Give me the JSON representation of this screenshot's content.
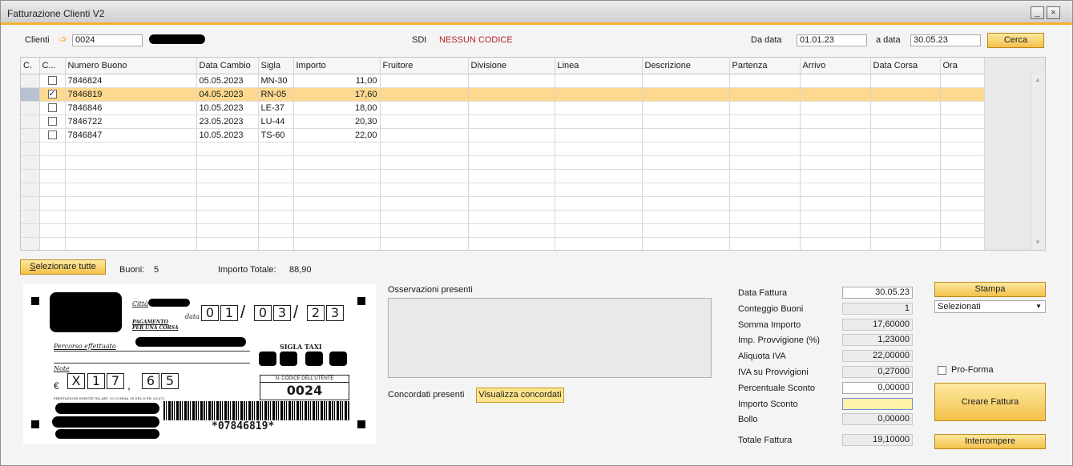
{
  "window": {
    "title": "Fatturazione Clienti V2",
    "minimize": "_",
    "close": "×"
  },
  "header": {
    "client_label": "Clienti",
    "client_value": "0024",
    "sdi_label": "SDI",
    "sdi_value": "NESSUN CODICE",
    "from_label": "Da data",
    "from_value": "01.01.23",
    "to_label": "a data",
    "to_value": "30.05.23",
    "search_button": "Cerca"
  },
  "grid": {
    "columns": [
      "C.",
      "C...",
      "Numero Buono",
      "Data Cambio",
      "Sigla",
      "Importo",
      "Fruitore",
      "Divisione",
      "Linea",
      "Descrizione",
      "Partenza",
      "Arrivo",
      "Data Corsa",
      "Ora"
    ],
    "rows": [
      {
        "checked": false,
        "numero": "7846824",
        "data": "05.05.2023",
        "sigla": "MN-30",
        "importo": "11,00"
      },
      {
        "checked": true,
        "numero": "7846819",
        "data": "04.05.2023",
        "sigla": "RN-05",
        "importo": "17,60"
      },
      {
        "checked": false,
        "numero": "7846846",
        "data": "10.05.2023",
        "sigla": "LE-37",
        "importo": "18,00"
      },
      {
        "checked": false,
        "numero": "7846722",
        "data": "23.05.2023",
        "sigla": "LU-44",
        "importo": "20,30"
      },
      {
        "checked": false,
        "numero": "7846847",
        "data": "10.05.2023",
        "sigla": "TS-60",
        "importo": "22,00"
      }
    ]
  },
  "summary": {
    "select_all_button": "Selezionare tutte",
    "buoni_label": "Buoni:",
    "buoni_value": "5",
    "total_label": "Importo Totale:",
    "total_value": "88,90"
  },
  "voucher": {
    "citta": "Città",
    "data_label": "data",
    "pagamento": "PAGAMENTO",
    "per_una_corsa": "PER UNA CORSA",
    "date_digits": [
      "0",
      "1",
      "0",
      "3",
      "2",
      "3"
    ],
    "percorso": "Percorso effettuato",
    "sigla_taxi": "SIGLA TAXI",
    "note": "Note",
    "euro": "€",
    "amount_digits": [
      "X",
      "1",
      "7",
      "6",
      "5"
    ],
    "amount_sep": ",",
    "codice_label": "N. CODICE DELL'UTENTE",
    "codice_value": "0024",
    "fine_print": "PRESTAZIONE ESENTE IVA ART. 10 COMMA 14 DEL D.P.R. 633/72",
    "barcode_text": "*07846819*"
  },
  "notes": {
    "observations_label": "Osservazioni presenti",
    "agreements_label": "Concordati presenti",
    "agreements_button": "Visualizza concordati"
  },
  "invoice": {
    "fields": [
      {
        "label": "Data Fattura",
        "value": "30.05.23",
        "style": "white"
      },
      {
        "label": "Conteggio Buoni",
        "value": "1",
        "style": "gray"
      },
      {
        "label": "Somma Importo",
        "value": "17,60000",
        "style": "gray"
      },
      {
        "label": "Imp. Provvigione (%)",
        "value": "1,23000",
        "style": "gray"
      },
      {
        "label": "Aliquota IVA",
        "value": "22,00000",
        "style": "gray"
      },
      {
        "label": "IVA su Provvigioni",
        "value": "0,27000",
        "style": "gray"
      },
      {
        "label": "Percentuale Sconto",
        "value": "0,00000",
        "style": "white"
      },
      {
        "label": "Importo Sconto",
        "value": "",
        "style": "yellow"
      },
      {
        "label": "Bollo",
        "value": "0,00000",
        "style": "gray"
      },
      {
        "label": "Totale Fattura",
        "value": "19,10000",
        "style": "gray"
      }
    ],
    "print_button": "Stampa",
    "print_select": "Selezionati",
    "proforma_label": "Pro-Forma",
    "create_button": "Creare Fattura",
    "cancel_button": "Interrompere"
  }
}
